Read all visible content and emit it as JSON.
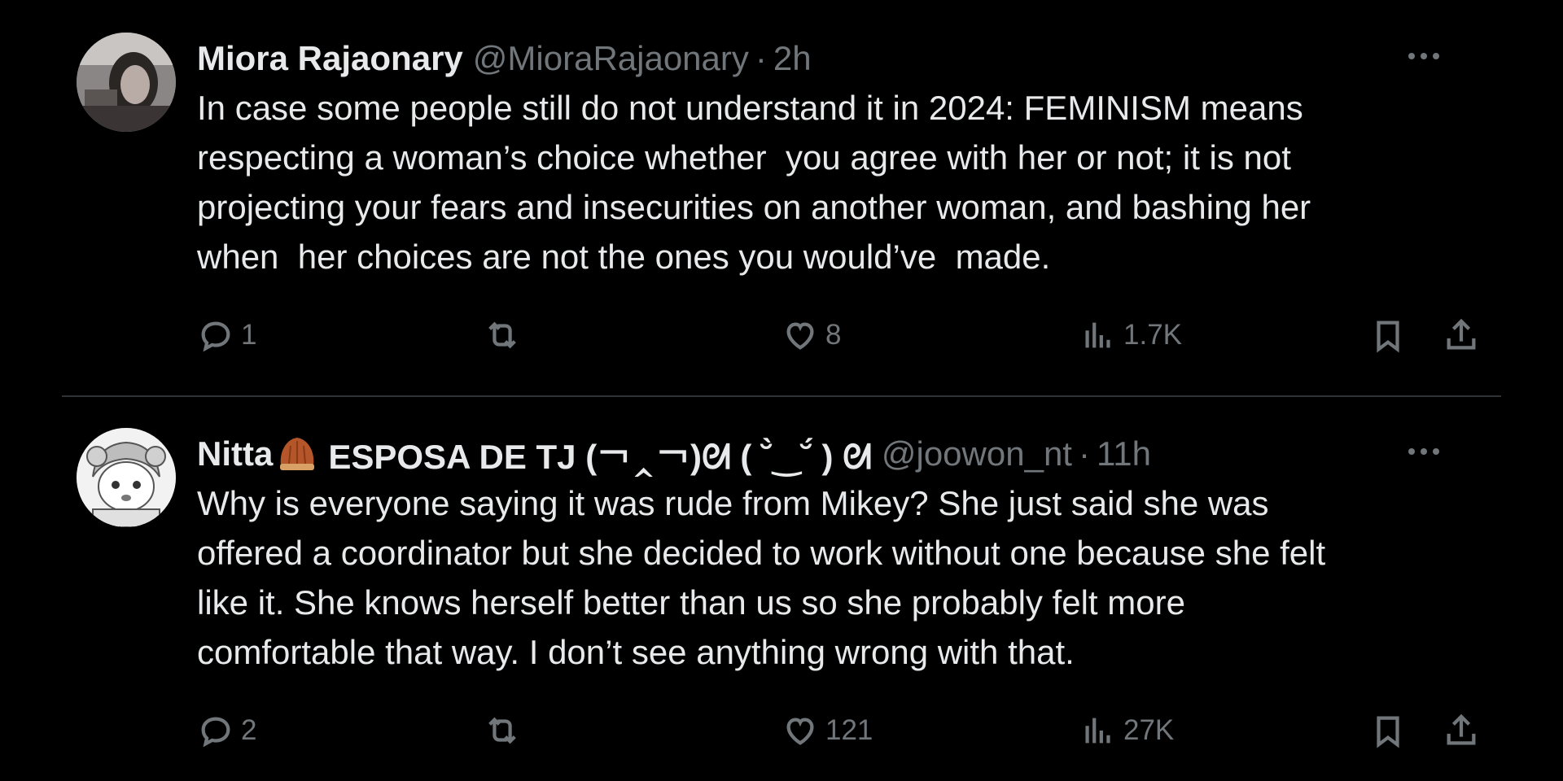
{
  "tweets": [
    {
      "author_name": "Miora Rajaonary",
      "author_emoji": "",
      "author_name_rest": "",
      "handle": "@MioraRajaonary",
      "separator": "·",
      "time": "2h",
      "text": "In case some people still do not understand it in 2024: FEMINISM means\nrespecting a woman’s choice whether  you agree with her or not; it is not\nprojecting your fears and insecurities on another woman, and bashing her\nwhen  her choices are not the ones you would’ve  made.",
      "reply_count": "1",
      "retweet_count": "",
      "like_count": "8",
      "view_count": "1.7K",
      "icons": [
        "reply-icon",
        "retweet-icon",
        "heart-icon",
        "views-icon",
        "bookmark-icon",
        "share-icon",
        "more-icon"
      ]
    },
    {
      "author_name": "Nitta",
      "author_emoji": "🌰",
      "author_name_rest": "ESPOSA DE TJ (￢‸￢)ᘛ ( ˘̀‿˘́ ) ᘛ",
      "handle": "@joowon_nt",
      "separator": "·",
      "time": "11h",
      "text": "Why is everyone saying it was rude from Mikey? She just said she was\noffered a coordinator but she decided to work without one because she felt\nlike it. She knows herself better than us so she probably felt more\ncomfortable that way. I don’t see anything wrong with that.",
      "reply_count": "2",
      "retweet_count": "",
      "like_count": "121",
      "view_count": "27K",
      "icons": [
        "reply-icon",
        "retweet-icon",
        "heart-icon",
        "views-icon",
        "bookmark-icon",
        "share-icon",
        "more-icon"
      ]
    }
  ],
  "colors": {
    "background": "#000000",
    "text": "#e7e9ea",
    "muted": "#71767b",
    "divider": "#2f3336",
    "emoji": "#a0522d"
  }
}
